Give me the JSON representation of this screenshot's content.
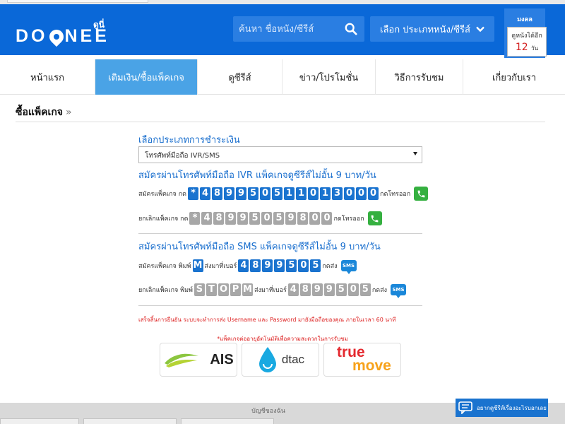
{
  "header": {
    "logo": "DOONEE",
    "logo_sup": "ดูนี่",
    "search_placeholder": "ค้นหา ชื่อหนัง/ซีรีส์",
    "type_select": "เลือก ประเภทหนัง/ซีรีส์",
    "remaining": {
      "title": "มงคล",
      "label": "ดูหนังได้อีก",
      "value": "12",
      "unit": "วัน"
    }
  },
  "nav": {
    "items": [
      {
        "label": "หน้าแรก"
      },
      {
        "label": "เติมเงิน/ซื้อแพ็คเกจ"
      },
      {
        "label": "ดูซีรีส์"
      },
      {
        "label": "ข่าว/โปรโมชั่น"
      },
      {
        "label": "วิธีการรับชม"
      },
      {
        "label": "เกี่ยวกับเรา"
      }
    ],
    "active_index": 1
  },
  "page": {
    "title": "ซื้อแพ็คเกจ",
    "raquo": "»"
  },
  "payment": {
    "heading": "เลือกประเภทการชำระเงิน",
    "selected": "โทรศัพท์มือถือ IVR/SMS"
  },
  "ivr": {
    "heading": "สมัครผ่านโทรศัพท์มือถือ IVR แพ็คเกจดูซีรีส์ไม่อั้น 9 บาท/วัน",
    "subscribe": {
      "prefix": "สมัครแพ็คเกจ กด",
      "digits": [
        "*",
        "4",
        "8",
        "9",
        "9",
        "5",
        "0",
        "5",
        "1",
        "1",
        "0",
        "1",
        "3",
        "0",
        "0",
        "0"
      ],
      "suffix": "กดโทรออก"
    },
    "cancel": {
      "prefix": "ยกเลิกแพ็คเกจ กด",
      "digits": [
        "*",
        "4",
        "8",
        "9",
        "9",
        "5",
        "0",
        "5",
        "9",
        "8",
        "0",
        "0"
      ],
      "suffix": "กดโทรออก"
    }
  },
  "sms": {
    "heading": "สมัครผ่านโทรศัพท์มือถือ SMS แพ็คเกจดูซีรีส์ไม่อั้น 9 บาท/วัน",
    "subscribe": {
      "prefix": "สมัครแพ็คเกจ พิมพ์",
      "keyword": [
        "M"
      ],
      "mid": "ส่งมาที่เบอร์",
      "number": [
        "4",
        "8",
        "9",
        "9",
        "5",
        "0",
        "5"
      ],
      "suffix": "กดส่ง",
      "button": "SMS"
    },
    "cancel": {
      "prefix": "ยกเลิกแพ็คเกจ พิมพ์",
      "keyword": [
        "S",
        "T",
        "O",
        "P",
        "M"
      ],
      "mid": "ส่งมาที่เบอร์",
      "number": [
        "4",
        "8",
        "9",
        "9",
        "5",
        "0",
        "5"
      ],
      "suffix": "กดส่ง",
      "button": "SMS"
    }
  },
  "notes": {
    "confirm": "เสร็จสิ้นการยืนยัน ระบบจะทำการส่ง Username และ Password มายังมือถือของคุณ ภายในเวลา 60 นาที",
    "operators": "*แพ็คเกจต่ออายุอัตโนมัติเพื่อความสะดวกในการรับชม"
  },
  "operators": {
    "ais": "AIS",
    "dtac": "dtac",
    "true": "true",
    "move": "move"
  },
  "footer": {
    "label": "บัญชีของฉัน"
  },
  "chat": {
    "label": "อยากดูซีรีส์เรื่องอะไรบอกเลย"
  },
  "colors": {
    "brand": "#0a68d8",
    "nav_active": "#4aa3e6",
    "digit": "#1a73cf",
    "digit_grey": "#a7a7a7",
    "call_green": "#35b040",
    "alert_red": "#d22222"
  }
}
